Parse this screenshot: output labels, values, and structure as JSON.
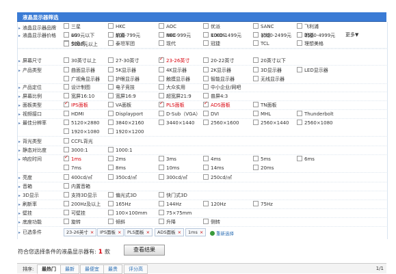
{
  "header": {
    "title": "液晶显示器筛选"
  },
  "filters": [
    {
      "label": "液晶显示器品牌",
      "options": [
        "三星",
        "HKC",
        "AOC",
        "优派",
        "SANC",
        "飞利浦",
        "LG",
        "航嘉",
        "NEC",
        "KOIOS",
        "长城",
        "明基",
        "剑鱼虎",
        "泰坦军团",
        "现代",
        "冠捷",
        "TCL",
        "理想美格"
      ],
      "checked": []
    },
    {
      "label": "液晶显示器价格",
      "options": [
        "499元以下",
        "500-799元",
        "800-999元",
        "1000-1499元",
        "1500-2499元",
        "2500-4999元",
        "5000元以上"
      ],
      "checked": []
    },
    {
      "label": "屏幕尺寸",
      "options": [
        "30英寸以上",
        "27-30英寸",
        "23-26英寸",
        "20-22英寸",
        "20英寸以下"
      ],
      "checked": [
        "23-26英寸"
      ]
    },
    {
      "label": "产品类型",
      "options": [
        "曲面显示器",
        "5K显示器",
        "4K显示器",
        "2K显示器",
        "3D显示器",
        "LED显示器",
        "广视角显示器",
        "护眼显示器",
        "触摸显示器",
        "智能显示器",
        "无线显示器"
      ],
      "checked": []
    },
    {
      "label": "产品定位",
      "options": [
        "设计制图",
        "电子竞技",
        "大众实用",
        "中小企业/网吧"
      ],
      "checked": []
    },
    {
      "label": "屏幕比例",
      "options": [
        "宽屏16:10",
        "宽屏16:9",
        "超宽屏21:9",
        "普屏4:3"
      ],
      "checked": []
    },
    {
      "label": "面板类型",
      "options": [
        "IPS面板",
        "VA面板",
        "PLS面板",
        "ADS面板",
        "TN面板"
      ],
      "checked": [
        "IPS面板",
        "PLS面板",
        "ADS面板"
      ]
    },
    {
      "label": "视频接口",
      "options": [
        "HDMI",
        "Displayport",
        "D-Sub（VGA）",
        "DVI",
        "MHL",
        "Thunderbolt"
      ],
      "checked": []
    },
    {
      "label": "最佳分辨率",
      "options": [
        "5120×2880",
        "3840×2160",
        "3440×1440",
        "2560×1600",
        "2560×1440",
        "2560×1080",
        "1920×1080",
        "1920×1200"
      ],
      "checked": []
    },
    {
      "label": "背光类型",
      "options": [
        "CCFL背光"
      ],
      "checked": []
    },
    {
      "label": "静态对比度",
      "options": [
        "3000:1",
        "1000:1"
      ],
      "checked": []
    },
    {
      "label": "响应时间",
      "options": [
        "1ms",
        "2ms",
        "3ms",
        "4ms",
        "5ms",
        "6ms",
        "7ms",
        "8ms",
        "10ms",
        "14ms",
        "20ms"
      ],
      "checked": [
        "1ms"
      ]
    },
    {
      "label": "亮度",
      "options": [
        "400cd/㎡",
        "350cd/㎡",
        "300cd/㎡",
        "250cd/㎡"
      ],
      "checked": []
    },
    {
      "label": "音箱",
      "options": [
        "内置音箱"
      ],
      "checked": []
    },
    {
      "label": "3D显示",
      "options": [
        "支持3D显示",
        "偏光式3D",
        "快门式3D"
      ],
      "checked": []
    },
    {
      "label": "刷新率",
      "options": [
        "200Hz及以上",
        "165Hz",
        "144Hz",
        "120Hz",
        "75Hz"
      ],
      "checked": []
    },
    {
      "label": "壁挂",
      "options": [
        "可壁挂",
        "100×100mm",
        "75×75mm"
      ],
      "checked": []
    },
    {
      "label": "底座功能",
      "options": [
        "旋转",
        "倾斜",
        "升降",
        "侧转"
      ],
      "checked": []
    }
  ],
  "more_label": "更多▼",
  "selected": {
    "label": "已选条件",
    "chips": [
      "23-26英寸",
      "IPS面板",
      "PLS面板",
      "ADS面板",
      "1ms"
    ],
    "chip_close": "×",
    "reset_label": "重新选择"
  },
  "result": {
    "prefix": "符合您选择条件的液晶显示器有:",
    "count": "1",
    "suffix": "款"
  },
  "view_button": "查看结果",
  "sort": {
    "label": "排序:",
    "tabs": [
      "最热门",
      "最新",
      "最便宜",
      "最贵",
      "评分高"
    ],
    "active": 0,
    "page": "1/1"
  }
}
